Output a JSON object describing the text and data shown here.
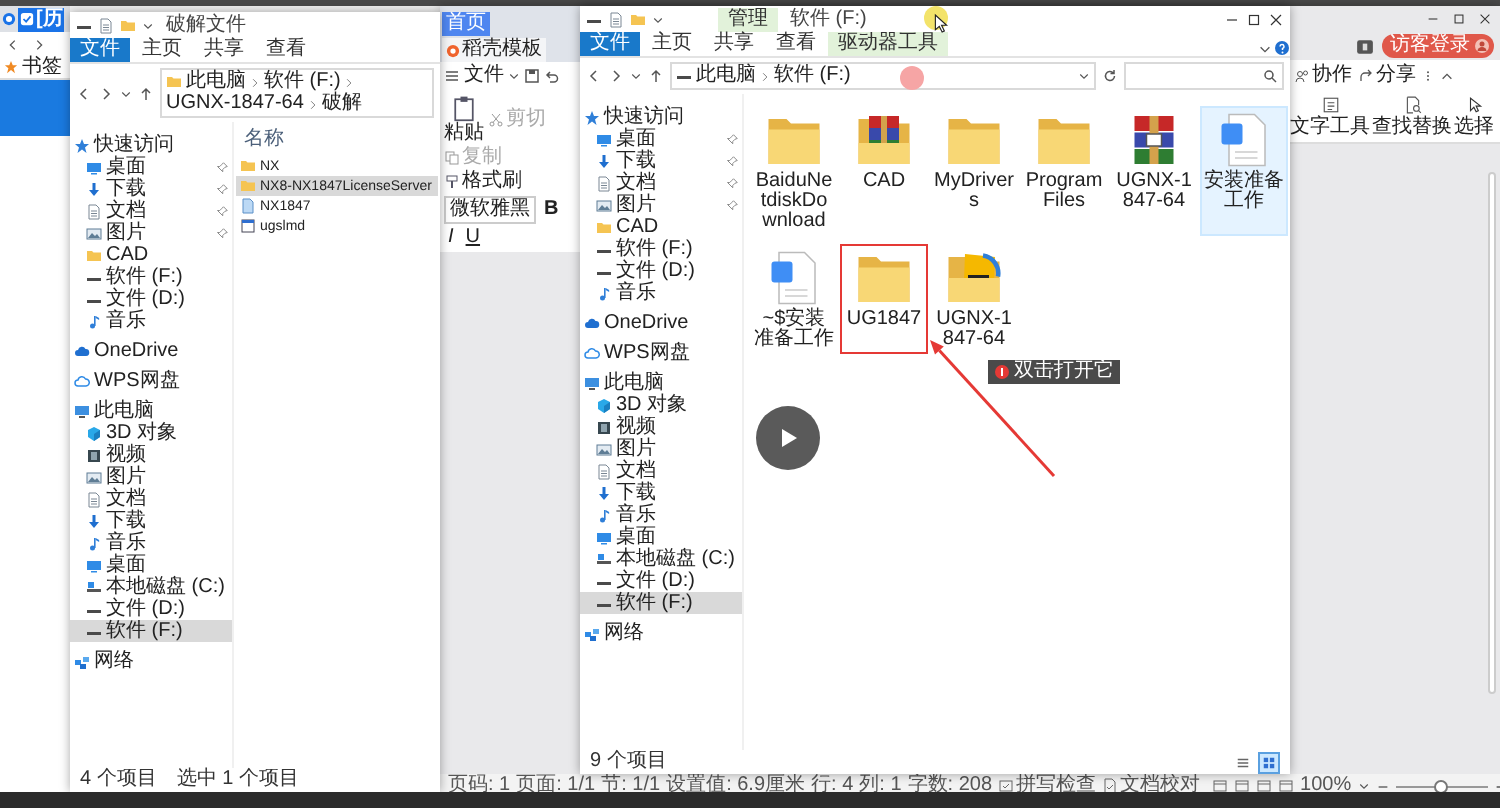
{
  "browser": {
    "tab": {
      "label": "[历",
      "selected": true
    },
    "bookmark": "书签"
  },
  "explorer_back": {
    "title": "破解文件",
    "ribbon_tabs": [
      {
        "label": "文件",
        "selected": true
      },
      {
        "label": "主页",
        "selected": false
      },
      {
        "label": "共享",
        "selected": false
      },
      {
        "label": "查看",
        "selected": false
      }
    ],
    "breadcrumb": [
      "此电脑",
      "软件 (F:)",
      "UGNX-1847-64",
      "破解"
    ],
    "nav": [
      {
        "label": "快速访问",
        "kind": "star",
        "selected": false,
        "children": [
          {
            "label": "桌面",
            "kind": "desktop",
            "pinned": true,
            "selected": false
          },
          {
            "label": "下载",
            "kind": "download",
            "pinned": true,
            "selected": false
          },
          {
            "label": "文档",
            "kind": "document",
            "pinned": true,
            "selected": false
          },
          {
            "label": "图片",
            "kind": "picture",
            "pinned": true,
            "selected": false
          },
          {
            "label": "CAD",
            "kind": "folder",
            "pinned": false,
            "selected": false
          },
          {
            "label": "软件 (F:)",
            "kind": "drive",
            "pinned": false,
            "selected": false
          },
          {
            "label": "文件 (D:)",
            "kind": "drive",
            "pinned": false,
            "selected": false
          },
          {
            "label": "音乐",
            "kind": "music",
            "pinned": false,
            "selected": false
          }
        ]
      },
      {
        "label": "OneDrive",
        "kind": "cloud",
        "selected": false
      },
      {
        "label": "WPS网盘",
        "kind": "wps-cloud",
        "selected": false
      },
      {
        "label": "此电脑",
        "kind": "computer",
        "selected": false,
        "children": [
          {
            "label": "3D 对象",
            "kind": "cube",
            "selected": false
          },
          {
            "label": "视频",
            "kind": "video",
            "selected": false
          },
          {
            "label": "图片",
            "kind": "picture",
            "selected": false
          },
          {
            "label": "文档",
            "kind": "document",
            "selected": false
          },
          {
            "label": "下载",
            "kind": "download",
            "selected": false
          },
          {
            "label": "音乐",
            "kind": "music",
            "selected": false
          },
          {
            "label": "桌面",
            "kind": "desktop",
            "selected": false
          },
          {
            "label": "本地磁盘 (C:)",
            "kind": "local-disk",
            "selected": false
          },
          {
            "label": "文件 (D:)",
            "kind": "drive",
            "selected": false
          },
          {
            "label": "软件 (F:)",
            "kind": "drive",
            "selected": true
          }
        ]
      },
      {
        "label": "网络",
        "kind": "network",
        "selected": false
      }
    ],
    "column_header": "名称",
    "files": [
      {
        "name": "NX",
        "kind": "folder",
        "selected": false
      },
      {
        "name": "NX8-NX1847LicenseServer",
        "kind": "folder",
        "selected": true
      },
      {
        "name": "NX1847",
        "kind": "file",
        "selected": false
      },
      {
        "name": "ugslmd",
        "kind": "exe",
        "selected": false
      }
    ],
    "status": [
      "4 个项目",
      "选中 1 个项目"
    ]
  },
  "wps": {
    "tabs": [
      {
        "label": "首页",
        "kind": "home",
        "selected": true
      },
      {
        "label": "稻壳模板",
        "kind": "template",
        "selected": false
      }
    ],
    "file_menu": "文件",
    "clipboard": [
      {
        "label": "粘贴",
        "kind": "paste",
        "disabled": false
      },
      {
        "label": "剪切",
        "kind": "cut",
        "disabled": true
      },
      {
        "label": "复制",
        "kind": "copy",
        "disabled": true
      },
      {
        "label": "格式刷",
        "kind": "brush",
        "disabled": false
      }
    ],
    "font": "微软雅黑",
    "format_buttons": [
      "B",
      "I",
      "U"
    ],
    "login_button": "访客登录",
    "actions": [
      {
        "label": "协作",
        "kind": "collab"
      },
      {
        "label": "分享",
        "kind": "share"
      }
    ],
    "tools": [
      {
        "label": "文字工具",
        "kind": "text"
      },
      {
        "label": "查找替换",
        "kind": "find"
      },
      {
        "label": "选择",
        "kind": "select"
      }
    ],
    "status": [
      {
        "label": "页码: 1",
        "kind": "text"
      },
      {
        "label": "页面: 1/1",
        "kind": "text"
      },
      {
        "label": "节: 1/1",
        "kind": "text"
      },
      {
        "label": "设置值: 6.9厘米",
        "kind": "text"
      },
      {
        "label": "行: 4",
        "kind": "text"
      },
      {
        "label": "列: 1",
        "kind": "text"
      },
      {
        "label": "字数: 208",
        "kind": "text"
      },
      {
        "label": "拼写检查",
        "kind": "spell"
      },
      {
        "label": "文档校对",
        "kind": "proof"
      }
    ],
    "zoom": {
      "reading": "100%",
      "level": 0.5
    }
  },
  "explorer_front": {
    "context_tab": "管理",
    "title": "软件 (F:)",
    "ribbon_tabs": [
      {
        "label": "文件",
        "selected": true,
        "contextual": false
      },
      {
        "label": "主页",
        "selected": false,
        "contextual": false
      },
      {
        "label": "共享",
        "selected": false,
        "contextual": false
      },
      {
        "label": "查看",
        "selected": false,
        "contextual": false
      },
      {
        "label": "驱动器工具",
        "selected": false,
        "contextual": true
      }
    ],
    "breadcrumb": [
      "此电脑",
      "软件 (F:)"
    ],
    "nav": [
      {
        "label": "快速访问",
        "kind": "star",
        "selected": false,
        "children": [
          {
            "label": "桌面",
            "kind": "desktop",
            "pinned": true,
            "selected": false
          },
          {
            "label": "下载",
            "kind": "download",
            "pinned": true,
            "selected": false
          },
          {
            "label": "文档",
            "kind": "document",
            "pinned": true,
            "selected": false
          },
          {
            "label": "图片",
            "kind": "picture",
            "pinned": true,
            "selected": false
          },
          {
            "label": "CAD",
            "kind": "folder",
            "pinned": false,
            "selected": false
          },
          {
            "label": "软件 (F:)",
            "kind": "drive",
            "pinned": false,
            "selected": false
          },
          {
            "label": "文件 (D:)",
            "kind": "drive",
            "pinned": false,
            "selected": false
          },
          {
            "label": "音乐",
            "kind": "music",
            "pinned": false,
            "selected": false
          }
        ]
      },
      {
        "label": "OneDrive",
        "kind": "cloud",
        "selected": false
      },
      {
        "label": "WPS网盘",
        "kind": "wps-cloud",
        "selected": false
      },
      {
        "label": "此电脑",
        "kind": "computer",
        "selected": false,
        "children": [
          {
            "label": "3D 对象",
            "kind": "cube",
            "selected": false
          },
          {
            "label": "视频",
            "kind": "video",
            "selected": false
          },
          {
            "label": "图片",
            "kind": "picture",
            "selected": false
          },
          {
            "label": "文档",
            "kind": "document",
            "selected": false
          },
          {
            "label": "下载",
            "kind": "download",
            "selected": false
          },
          {
            "label": "音乐",
            "kind": "music",
            "selected": false
          },
          {
            "label": "桌面",
            "kind": "desktop",
            "selected": false
          },
          {
            "label": "本地磁盘 (C:)",
            "kind": "local-disk",
            "selected": false
          },
          {
            "label": "文件 (D:)",
            "kind": "drive",
            "selected": false
          },
          {
            "label": "软件 (F:)",
            "kind": "drive",
            "selected": true
          }
        ]
      },
      {
        "label": "网络",
        "kind": "network",
        "selected": false
      }
    ],
    "items": [
      {
        "name": "BaiduNetdiskDownload",
        "kind": "folder",
        "selected": false,
        "marked": false
      },
      {
        "name": "CAD",
        "kind": "archive-folder",
        "selected": false,
        "marked": false
      },
      {
        "name": "MyDrivers",
        "kind": "folder",
        "selected": false,
        "marked": false
      },
      {
        "name": "Program Files",
        "kind": "folder",
        "selected": false,
        "marked": false
      },
      {
        "name": "UGNX-1847-64",
        "kind": "archive",
        "selected": false,
        "marked": false
      },
      {
        "name": "安装准备工作",
        "kind": "document",
        "selected": true,
        "marked": false
      },
      {
        "name": "~$安装准备工作",
        "kind": "document",
        "selected": false,
        "marked": false
      },
      {
        "name": "UG1847",
        "kind": "folder",
        "selected": false,
        "marked": true
      },
      {
        "name": "UGNX-1847-64",
        "kind": "image-folder",
        "selected": false,
        "marked": false
      }
    ],
    "callout": "双击打开它",
    "status": "9 个项目",
    "view_modes": [
      {
        "kind": "details",
        "selected": false
      },
      {
        "kind": "large-icons",
        "selected": true
      }
    ]
  }
}
